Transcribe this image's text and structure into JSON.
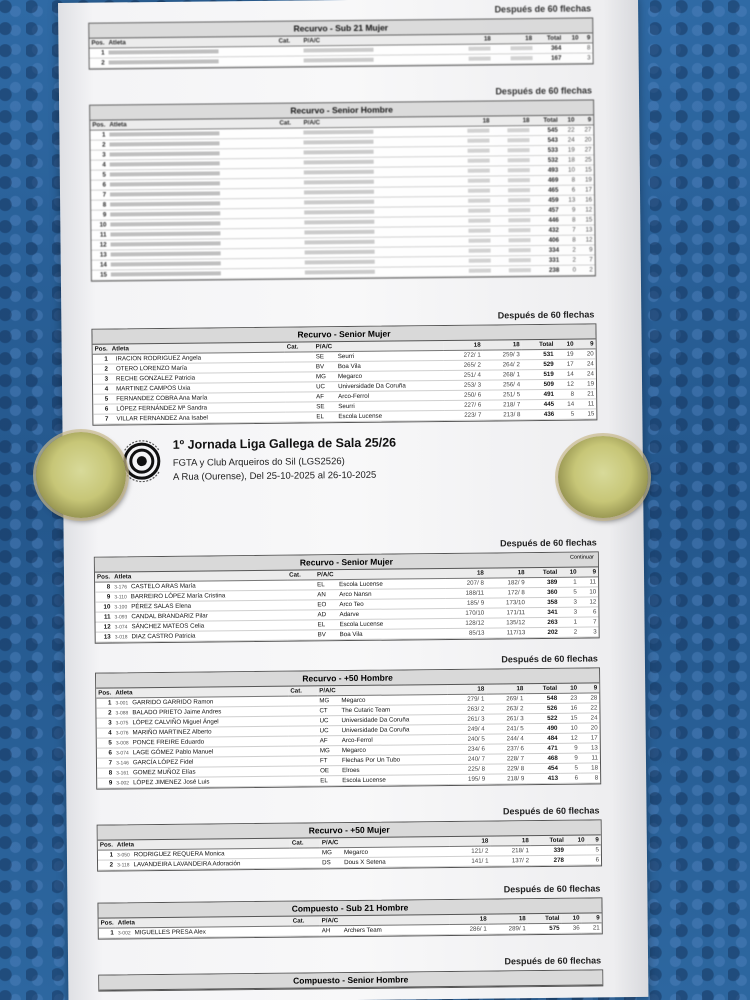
{
  "caption_60": "Después de 60 flechas",
  "col": {
    "pos": "Pos.",
    "atleta": "Atleta",
    "cat": "Cat.",
    "piac": "P/A/C",
    "d18": "18",
    "total": "Total",
    "c10": "10",
    "c9": "9"
  },
  "header": {
    "title": "1º Jornada Liga Gallega de Sala 25/26",
    "organizer": "FGTA y Club Arqueiros do Sil (LGS2526)",
    "venue": "A Rua (Ourense), Del 25-10-2025 al 26-10-2025"
  },
  "s_sub21": {
    "title": "Recurvo - Sub 21 Mujer",
    "rows": [
      {
        "pos": "1",
        "atleta": "",
        "cat": "",
        "piac": "",
        "a": "",
        "b": "",
        "total": "364",
        "x10": "",
        "x9": "8"
      },
      {
        "pos": "2",
        "atleta": "",
        "cat": "",
        "piac": "",
        "a": "",
        "b": "",
        "total": "167",
        "x10": "",
        "x9": "3"
      }
    ]
  },
  "s_senior_h": {
    "title": "Recurvo - Senior Hombre",
    "rows": [
      {
        "pos": "1",
        "atleta": "",
        "piac": "",
        "total": "545",
        "x10": "22",
        "x9": "27"
      },
      {
        "pos": "2",
        "atleta": "",
        "piac": "",
        "total": "543",
        "x10": "24",
        "x9": "20"
      },
      {
        "pos": "3",
        "atleta": "",
        "piac": "",
        "total": "533",
        "x10": "19",
        "x9": "27"
      },
      {
        "pos": "4",
        "atleta": "",
        "piac": "",
        "total": "532",
        "x10": "18",
        "x9": "25"
      },
      {
        "pos": "5",
        "atleta": "",
        "piac": "",
        "total": "493",
        "x10": "10",
        "x9": "15"
      },
      {
        "pos": "6",
        "atleta": "",
        "piac": "",
        "total": "469",
        "x10": "8",
        "x9": "19"
      },
      {
        "pos": "7",
        "atleta": "",
        "piac": "",
        "total": "465",
        "x10": "6",
        "x9": "17"
      },
      {
        "pos": "8",
        "atleta": "",
        "piac": "",
        "total": "459",
        "x10": "13",
        "x9": "16"
      },
      {
        "pos": "9",
        "atleta": "",
        "piac": "",
        "total": "457",
        "x10": "9",
        "x9": "12"
      },
      {
        "pos": "10",
        "atleta": "",
        "piac": "",
        "total": "446",
        "x10": "8",
        "x9": "15"
      },
      {
        "pos": "11",
        "atleta": "",
        "piac": "",
        "total": "432",
        "x10": "7",
        "x9": "13"
      },
      {
        "pos": "12",
        "atleta": "",
        "piac": "",
        "total": "406",
        "x10": "8",
        "x9": "12"
      },
      {
        "pos": "13",
        "atleta": "",
        "piac": "",
        "total": "334",
        "x10": "2",
        "x9": "9"
      },
      {
        "pos": "14",
        "atleta": "",
        "piac": "",
        "total": "331",
        "x10": "2",
        "x9": "7"
      },
      {
        "pos": "15",
        "atleta": "",
        "piac": "",
        "total": "238",
        "x10": "0",
        "x9": "2"
      }
    ]
  },
  "s_senior_m1": {
    "title": "Recurvo - Senior Mujer",
    "rows": [
      {
        "pos": "1",
        "lic": "",
        "atleta": "IRACION RODRIGUEZ Angela",
        "piac": "SE",
        "club": "Seurri",
        "a": "272/ 1",
        "b": "259/ 3",
        "total": "531",
        "x10": "19",
        "x9": "20"
      },
      {
        "pos": "2",
        "lic": "",
        "atleta": "OTERO LORENZO María",
        "piac": "BV",
        "club": "Boa Vila",
        "a": "265/ 2",
        "b": "264/ 2",
        "total": "529",
        "x10": "17",
        "x9": "24"
      },
      {
        "pos": "3",
        "lic": "",
        "atleta": "RECHE GONZALEZ Patricia",
        "piac": "MG",
        "club": "Megarco",
        "a": "251/ 4",
        "b": "268/ 1",
        "total": "519",
        "x10": "14",
        "x9": "24"
      },
      {
        "pos": "4",
        "lic": "",
        "atleta": "MARTINEZ CAMPOS Uxia",
        "piac": "UC",
        "club": "Universidade Da Coruña",
        "a": "253/ 3",
        "b": "256/ 4",
        "total": "509",
        "x10": "12",
        "x9": "19"
      },
      {
        "pos": "5",
        "lic": "",
        "atleta": "FERNANDEZ COBRA Ana María",
        "piac": "AF",
        "club": "Arco-Ferrol",
        "a": "250/ 6",
        "b": "251/ 5",
        "total": "491",
        "x10": "8",
        "x9": "21"
      },
      {
        "pos": "6",
        "lic": "",
        "atleta": "LÓPEZ FERNÁNDEZ Mª Sandra",
        "piac": "SE",
        "club": "Seurri",
        "a": "227/ 6",
        "b": "218/ 7",
        "total": "445",
        "x10": "14",
        "x9": "11"
      },
      {
        "pos": "7",
        "lic": "",
        "atleta": "VILLAR FERNANDEZ Ana Isabel",
        "piac": "EL",
        "club": "Escola Lucense",
        "a": "223/ 7",
        "b": "213/ 8",
        "total": "436",
        "x10": "5",
        "x9": "15"
      }
    ]
  },
  "s_senior_m2": {
    "title": "Recurvo - Senior Mujer",
    "continued": "Continuar",
    "rows": [
      {
        "pos": "8",
        "lic": "3-176",
        "atleta": "CASTELO ARAS María",
        "piac": "EL",
        "club": "Escola Lucense",
        "a": "207/ 8",
        "b": "182/ 9",
        "total": "389",
        "x10": "1",
        "x9": "11"
      },
      {
        "pos": "9",
        "lic": "3-110",
        "atleta": "BARREIRO LÓPEZ María Cristina",
        "piac": "AN",
        "club": "Arco Nansn",
        "a": "188/11",
        "b": "172/ 8",
        "total": "360",
        "x10": "5",
        "x9": "10"
      },
      {
        "pos": "10",
        "lic": "3-100",
        "atleta": "PÉREZ SALAS Elena",
        "piac": "EO",
        "club": "Arco Teo",
        "a": "185/ 9",
        "b": "173/10",
        "total": "358",
        "x10": "3",
        "x9": "12"
      },
      {
        "pos": "11",
        "lic": "3-093",
        "atleta": "CANDAL BRANDARIZ Pilar",
        "piac": "AD",
        "club": "Adarve",
        "a": "170/10",
        "b": "171/11",
        "total": "341",
        "x10": "3",
        "x9": "6"
      },
      {
        "pos": "12",
        "lic": "3-074",
        "atleta": "SÁNCHEZ MATEOS Celia",
        "piac": "EL",
        "club": "Escola Lucense",
        "a": "128/12",
        "b": "135/12",
        "total": "263",
        "x10": "1",
        "x9": "7"
      },
      {
        "pos": "13",
        "lic": "3-018",
        "atleta": "DIAZ CASTRO Patricia",
        "piac": "BV",
        "club": "Boa Vila",
        "a": "85/13",
        "b": "117/13",
        "total": "202",
        "x10": "2",
        "x9": "3"
      }
    ]
  },
  "s_50h": {
    "title": "Recurvo - +50 Hombre",
    "rows": [
      {
        "pos": "1",
        "lic": "3-001",
        "atleta": "GARRIDO GARRIDO Ramon",
        "piac": "MG",
        "club": "Megarco",
        "a": "279/ 1",
        "b": "269/ 1",
        "total": "548",
        "x10": "23",
        "x9": "28"
      },
      {
        "pos": "2",
        "lic": "3-088",
        "atleta": "BALADO PRIETO Jaime Andres",
        "piac": "CT",
        "club": "The Cutaric Team",
        "a": "263/ 2",
        "b": "263/ 2",
        "total": "526",
        "x10": "16",
        "x9": "22"
      },
      {
        "pos": "3",
        "lic": "3-075",
        "atleta": "LÓPEZ CALVIÑO Miguel Ángel",
        "piac": "UC",
        "club": "Universidade Da Coruña",
        "a": "261/ 3",
        "b": "261/ 3",
        "total": "522",
        "x10": "15",
        "x9": "24"
      },
      {
        "pos": "4",
        "lic": "3-076",
        "atleta": "MARIÑO MARTINEZ Alberto",
        "piac": "UC",
        "club": "Universidade Da Coruña",
        "a": "249/ 4",
        "b": "241/ 5",
        "total": "490",
        "x10": "10",
        "x9": "20"
      },
      {
        "pos": "5",
        "lic": "3-008",
        "atleta": "PONCE FREIRE Eduardo",
        "piac": "AF",
        "club": "Arco-Ferrol",
        "a": "240/ 5",
        "b": "244/ 4",
        "total": "484",
        "x10": "12",
        "x9": "17"
      },
      {
        "pos": "6",
        "lic": "3-074",
        "atleta": "LAGE GÓMEZ Pablo Manuel",
        "piac": "MG",
        "club": "Megarco",
        "a": "234/ 6",
        "b": "237/ 6",
        "total": "471",
        "x10": "9",
        "x9": "13"
      },
      {
        "pos": "7",
        "lic": "3-146",
        "atleta": "GARCÍA LÓPEZ Fidel",
        "piac": "FT",
        "club": "Flechas Por Un Tubo",
        "a": "240/ 7",
        "b": "228/ 7",
        "total": "468",
        "x10": "9",
        "x9": "11"
      },
      {
        "pos": "8",
        "lic": "3-161",
        "atleta": "GOMEZ MUÑOZ Elías",
        "piac": "OE",
        "club": "Elroes",
        "a": "225/ 8",
        "b": "229/ 8",
        "total": "454",
        "x10": "5",
        "x9": "18"
      },
      {
        "pos": "9",
        "lic": "3-002",
        "atleta": "LÓPEZ JIMENEZ José Luis",
        "piac": "EL",
        "club": "Escola Lucense",
        "a": "195/ 9",
        "b": "218/ 9",
        "total": "413",
        "x10": "6",
        "x9": "8"
      }
    ]
  },
  "s_50m": {
    "title": "Recurvo - +50 Mujer",
    "rows": [
      {
        "pos": "1",
        "lic": "3-050",
        "atleta": "RODRIGUEZ REQUERA Monica",
        "piac": "MG",
        "club": "Megarco",
        "a": "121/ 2",
        "b": "218/ 1",
        "total": "339",
        "x10": "",
        "x9": "5"
      },
      {
        "pos": "2",
        "lic": "3-118",
        "atleta": "LAVANDEIRA LAVANDEIRA Adoración",
        "piac": "DS",
        "club": "Dous X Setena",
        "a": "141/ 1",
        "b": "137/ 2",
        "total": "278",
        "x10": "",
        "x9": "6"
      }
    ]
  },
  "s_comp_sub21": {
    "title": "Compuesto - Sub 21 Hombre",
    "rows": [
      {
        "pos": "1",
        "lic": "3-002",
        "atleta": "MIGUELLES PRESA Alex",
        "piac": "AH",
        "club": "Archers Team",
        "a": "286/ 1",
        "b": "289/ 1",
        "total": "575",
        "x10": "36",
        "x9": "21"
      }
    ]
  },
  "s_comp_senior": {
    "title": "Compuesto - Senior Hombre"
  }
}
